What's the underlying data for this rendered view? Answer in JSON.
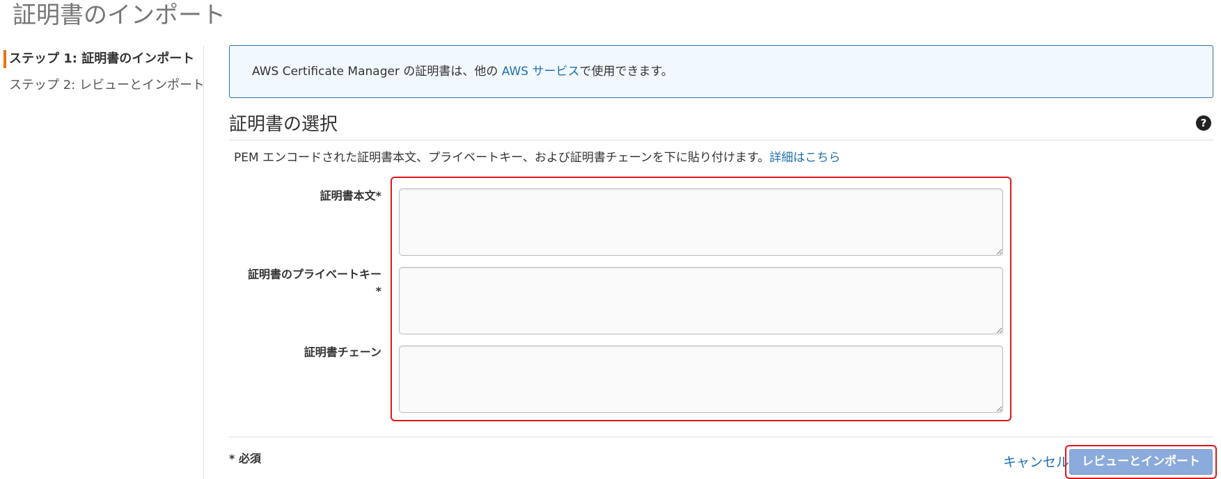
{
  "page": {
    "title": "証明書のインポート"
  },
  "steps": [
    {
      "label": "ステップ 1: 証明書のインポート",
      "active": true
    },
    {
      "label": "ステップ 2: レビューとインポート",
      "active": false
    }
  ],
  "info": {
    "text_before": "AWS Certificate Manager の証明書は、他の ",
    "link": "AWS サービス",
    "text_after": "で使用できます。"
  },
  "section": {
    "title": "証明書の選択",
    "help_icon": "question-circle-icon",
    "description": "PEM エンコードされた証明書本文、プライベートキー、および証明書チェーンを下に貼り付けます。",
    "details_link": "詳細はこちら"
  },
  "fields": {
    "body": {
      "label": "証明書本文*",
      "value": ""
    },
    "private_key": {
      "label": "証明書のプライベートキー*",
      "value": ""
    },
    "chain": {
      "label": "証明書チェーン",
      "value": ""
    }
  },
  "footer": {
    "required_note": "* 必須",
    "cancel": "キャンセル",
    "primary": "レビューとインポート"
  },
  "colors": {
    "accent": "#ec7211",
    "link": "#1f6fb2",
    "highlight": "#e0161b",
    "primary_button": "#8aabdb",
    "info_bg": "#f1f8fe",
    "info_border": "#2e6fb3"
  }
}
